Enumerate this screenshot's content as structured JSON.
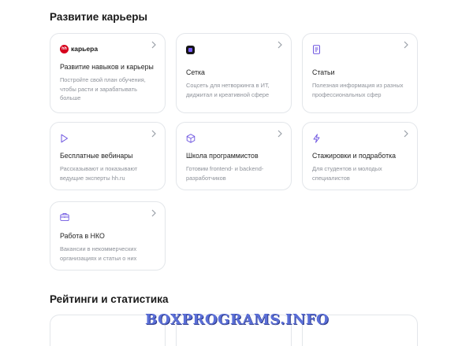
{
  "sections": [
    {
      "title": "Развитие карьеры"
    },
    {
      "title": "Рейтинги и статистика"
    }
  ],
  "cards": [
    {
      "brand": "карьера",
      "title": "Развитие навыков и карьеры",
      "desc": "Постройте свой план обучения, чтобы расти и зарабатывать больше",
      "icon": "hh-logo-icon"
    },
    {
      "title": "Сетка",
      "desc": "Соцсеть для нетворкинга в ИТ, диджитал и креативной сфере",
      "icon": "setka-logo-icon"
    },
    {
      "title": "Статьи",
      "desc": "Полезная информация из разных профессиональных сфер",
      "icon": "document-icon"
    },
    {
      "title": "Бесплатные вебинары",
      "desc": "Рассказывают и показывают ведущие эксперты hh.ru",
      "icon": "play-icon"
    },
    {
      "title": "Школа программистов",
      "desc": "Готовим frontend- и backend-разработчиков",
      "icon": "cube-icon"
    },
    {
      "title": "Стажировки и подработка",
      "desc": "Для студентов и молодых специалистов",
      "icon": "lightning-icon"
    },
    {
      "title": "Работа в НКО",
      "desc": "Вакансии в некоммерческих организациях и статьи о них",
      "icon": "briefcase-icon"
    }
  ],
  "hh_badge": "hh",
  "watermark": "BOXPROGRAMS.INFO",
  "colors": {
    "accent": "#7a5cff",
    "icon_stroke": "#6e55e0",
    "muted": "#8d9199",
    "border": "#e3e6ea"
  }
}
